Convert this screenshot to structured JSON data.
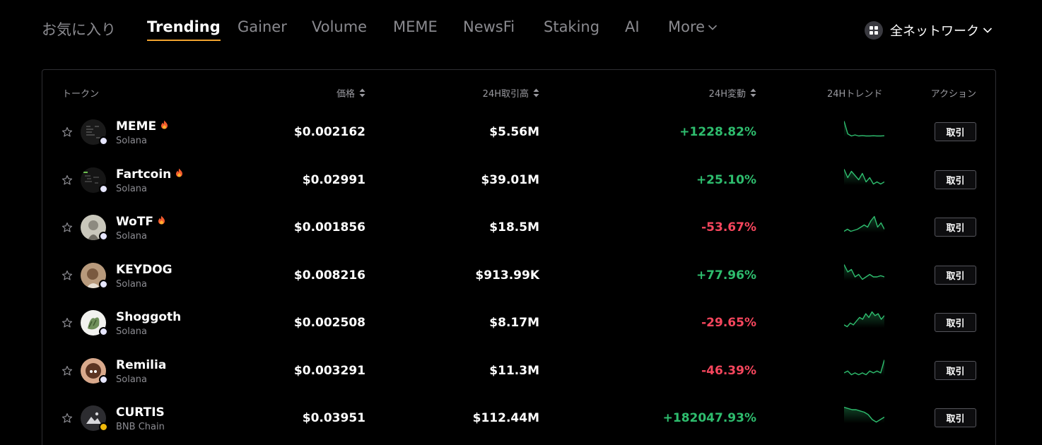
{
  "tabs": [
    {
      "label": "お気に入り"
    },
    {
      "label": "Trending"
    },
    {
      "label": "Gainer"
    },
    {
      "label": "Volume"
    },
    {
      "label": "MEME"
    },
    {
      "label": "NewsFi"
    },
    {
      "label": "Staking"
    },
    {
      "label": "AI"
    },
    {
      "label": "More"
    }
  ],
  "active_tab": "Trending",
  "network": {
    "label": "全ネットワーク",
    "icon": "grid-icon"
  },
  "table": {
    "headers": {
      "token": "トークン",
      "price": "価格",
      "volume": "24H取引高",
      "change": "24H変動",
      "trend": "24Hトレンド",
      "action": "アクション"
    },
    "rows": [
      {
        "name": "MEME",
        "chain": "Solana",
        "price": "$0.002162",
        "volume": "$5.56M",
        "change": "+1228.82%",
        "direction": "up",
        "hot": true,
        "trade": "取引",
        "trend": [
          9,
          3,
          2,
          2.5,
          2,
          2.2,
          2,
          2,
          2.1,
          2,
          2,
          2.1
        ]
      },
      {
        "name": "Fartcoin",
        "chain": "Solana",
        "price": "$0.02991",
        "volume": "$39.01M",
        "change": "+25.10%",
        "direction": "up",
        "hot": true,
        "trade": "取引",
        "trend": [
          9,
          5,
          8,
          6,
          4,
          7,
          3,
          5,
          2,
          3,
          2,
          3
        ]
      },
      {
        "name": "WoTF",
        "chain": "Solana",
        "price": "$0.001856",
        "volume": "$18.5M",
        "change": "-53.67%",
        "direction": "down",
        "hot": true,
        "trade": "取引",
        "trend": [
          2,
          3,
          2,
          2.5,
          3,
          4,
          5,
          4,
          7,
          9,
          4,
          6,
          3
        ]
      },
      {
        "name": "KEYDOG",
        "chain": "Solana",
        "price": "$0.008216",
        "volume": "$913.99K",
        "change": "+77.96%",
        "direction": "up",
        "hot": false,
        "trade": "取引",
        "trend": [
          9,
          6,
          7,
          4,
          5,
          3,
          4,
          5,
          4,
          4,
          4.5,
          4
        ]
      },
      {
        "name": "Shoggoth",
        "chain": "Solana",
        "price": "$0.002508",
        "volume": "$8.17M",
        "change": "-29.65%",
        "direction": "down",
        "hot": false,
        "trade": "取引",
        "trend": [
          2,
          1,
          3,
          2,
          4,
          6,
          5,
          8,
          6,
          9,
          7,
          8,
          5,
          7
        ]
      },
      {
        "name": "Remilia",
        "chain": "Solana",
        "price": "$0.003291",
        "volume": "$11.3M",
        "change": "-46.39%",
        "direction": "down",
        "hot": false,
        "trade": "取引",
        "trend": [
          3,
          4,
          2,
          3,
          2,
          3,
          2,
          4,
          3,
          4,
          3,
          10
        ]
      },
      {
        "name": "CURTIS",
        "chain": "BNB Chain",
        "price": "$0.03951",
        "volume": "$112.44M",
        "change": "+182047.93%",
        "direction": "up",
        "hot": false,
        "trade": "取引",
        "trend": [
          9,
          8.5,
          8,
          8,
          7.5,
          7,
          6,
          4,
          3,
          4,
          5
        ]
      }
    ]
  },
  "colors": {
    "up": "#2ebd6e",
    "down": "#f6465d",
    "accent": "#f0a22e",
    "solana_badge": "#e6e6ff",
    "bnb_badge": "#f0b90b"
  }
}
